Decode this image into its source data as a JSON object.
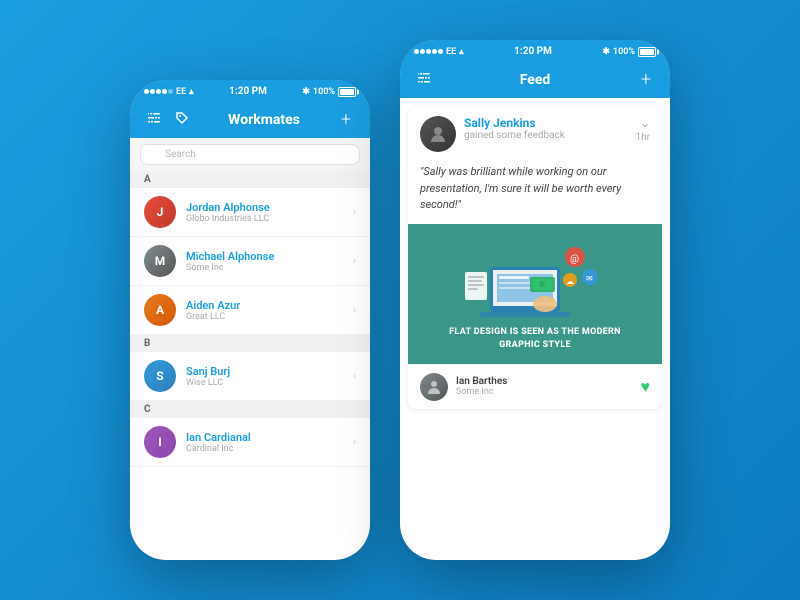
{
  "background": "#1a9de0",
  "phones": {
    "left": {
      "statusBar": {
        "dots": [
          true,
          true,
          true,
          true,
          false
        ],
        "carrier": "EE",
        "time": "1:20 PM",
        "batteryPercent": "100%"
      },
      "navBar": {
        "title": "Workmates",
        "leftIcon1": "sliders-icon",
        "leftIcon2": "tag-icon",
        "rightIcon": "plus-icon"
      },
      "search": {
        "placeholder": "Search"
      },
      "sections": [
        {
          "letter": "A",
          "contacts": [
            {
              "name": "Jordan Alphonse",
              "company": "Globo Industries LLC",
              "avatarInitial": "J",
              "avatarClass": "avatar-jordan"
            },
            {
              "name": "Michael Alphonse",
              "company": "Some Inc",
              "avatarInitial": "M",
              "avatarClass": "avatar-michael"
            },
            {
              "name": "Aiden Azur",
              "company": "Great LLC",
              "avatarInitial": "A",
              "avatarClass": "avatar-aiden"
            }
          ]
        },
        {
          "letter": "B",
          "contacts": [
            {
              "name": "Sanj Burj",
              "company": "Wise LLC",
              "avatarInitial": "S",
              "avatarClass": "avatar-sanj"
            }
          ]
        },
        {
          "letter": "C",
          "contacts": [
            {
              "name": "Ian Cardianal",
              "company": "Cardinal Inc",
              "avatarInitial": "I",
              "avatarClass": "avatar-ian"
            }
          ]
        }
      ]
    },
    "right": {
      "statusBar": {
        "dots": [
          true,
          true,
          true,
          true,
          true
        ],
        "carrier": "EE",
        "time": "1:20 PM",
        "batteryPercent": "100%"
      },
      "navBar": {
        "title": "Feed",
        "leftIcon": "sliders-icon",
        "rightIcon": "plus-icon"
      },
      "feedItem": {
        "userName": "Sally Jenkins",
        "action": "gained some feedback",
        "time": "1hr",
        "quote": "\"Sally was brilliant while working on our presentation, I'm sure it will be worth every second!\"",
        "imageLabel": "FLAT DESIGN IS SEEN AS THE\nMODERN GRAPHIC STYLE",
        "footerUser": {
          "name": "Ian Barthes",
          "company": "Some Inc"
        }
      }
    }
  }
}
